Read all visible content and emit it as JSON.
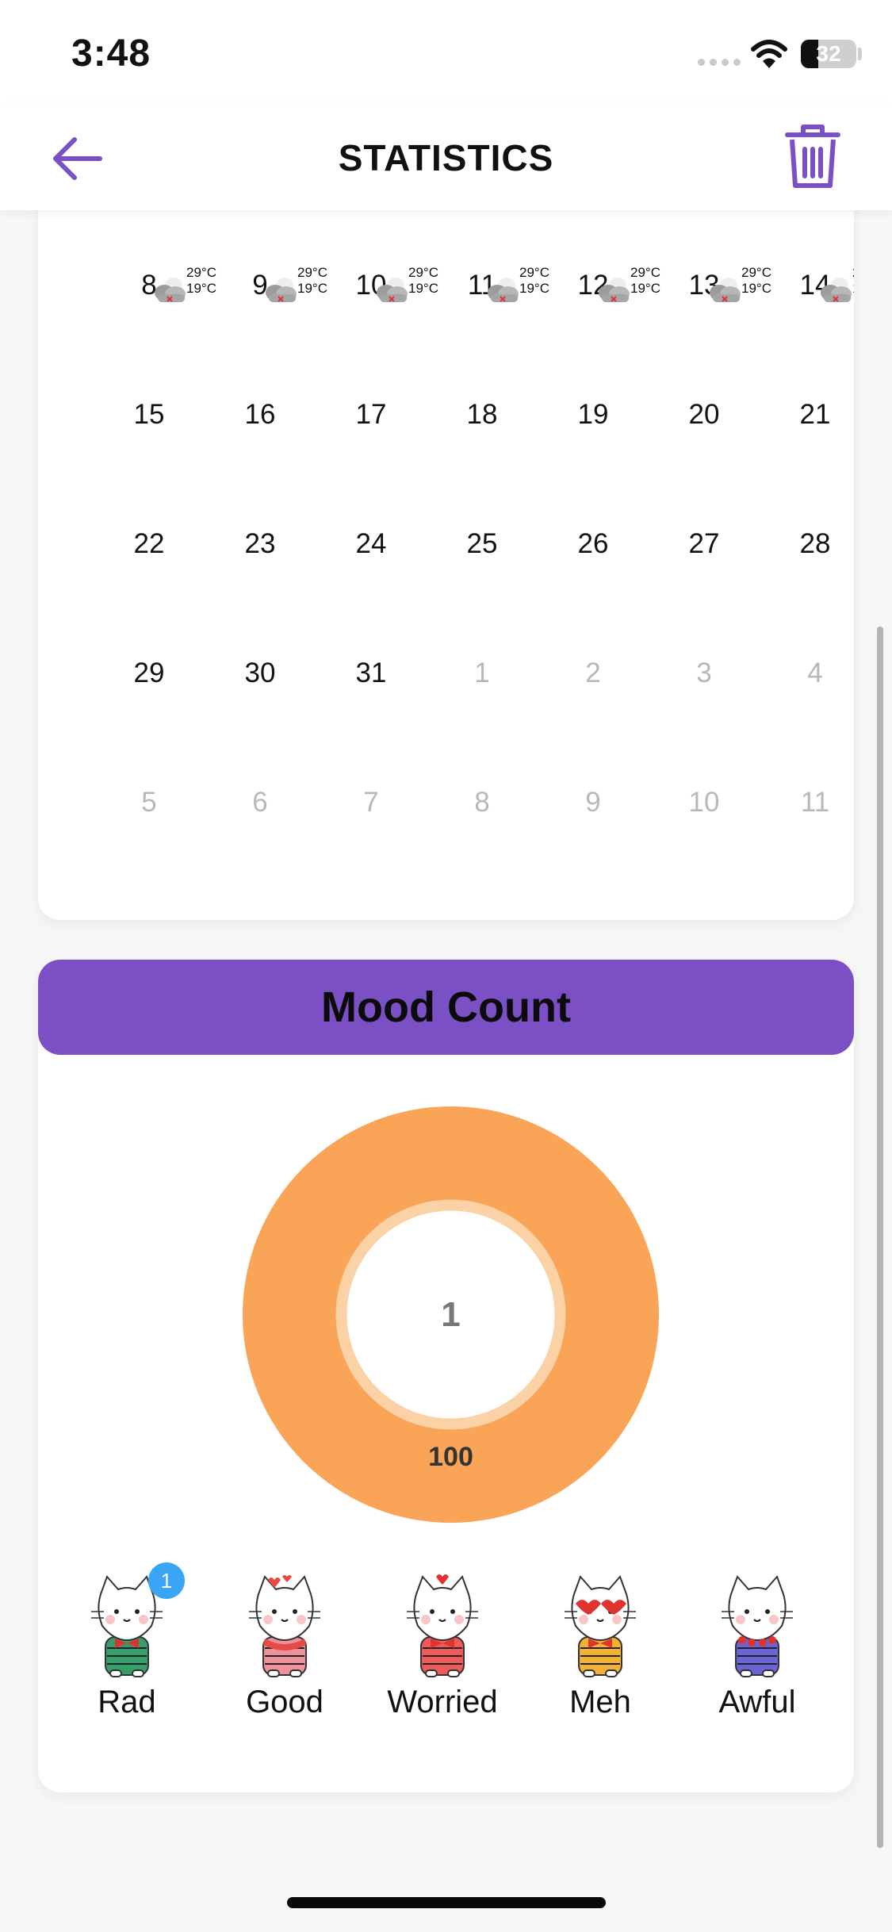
{
  "status_bar": {
    "time": "3:48",
    "battery_level": "32",
    "battery_fraction": 0.32
  },
  "header": {
    "title": "STATISTICS",
    "back_icon": "arrow-left-icon",
    "delete_icon": "trash-icon"
  },
  "calendar": {
    "weather": {
      "high": "29°C",
      "low": "19°C"
    },
    "rows": [
      [
        {
          "day": "8",
          "muted": false,
          "weather": true
        },
        {
          "day": "9",
          "muted": false,
          "weather": true
        },
        {
          "day": "10",
          "muted": false,
          "weather": true
        },
        {
          "day": "11",
          "muted": false,
          "weather": true
        },
        {
          "day": "12",
          "muted": false,
          "weather": true
        },
        {
          "day": "13",
          "muted": false,
          "weather": true
        },
        {
          "day": "14",
          "muted": false,
          "weather": true
        }
      ],
      [
        {
          "day": "15",
          "muted": false
        },
        {
          "day": "16",
          "muted": false
        },
        {
          "day": "17",
          "muted": false
        },
        {
          "day": "18",
          "muted": false
        },
        {
          "day": "19",
          "muted": false
        },
        {
          "day": "20",
          "muted": false
        },
        {
          "day": "21",
          "muted": false
        }
      ],
      [
        {
          "day": "22",
          "muted": false
        },
        {
          "day": "23",
          "muted": false
        },
        {
          "day": "24",
          "muted": false
        },
        {
          "day": "25",
          "muted": false
        },
        {
          "day": "26",
          "muted": false
        },
        {
          "day": "27",
          "muted": false
        },
        {
          "day": "28",
          "muted": false
        }
      ],
      [
        {
          "day": "29",
          "muted": false
        },
        {
          "day": "30",
          "muted": false
        },
        {
          "day": "31",
          "muted": false
        },
        {
          "day": "1",
          "muted": true
        },
        {
          "day": "2",
          "muted": true
        },
        {
          "day": "3",
          "muted": true
        },
        {
          "day": "4",
          "muted": true
        }
      ],
      [
        {
          "day": "5",
          "muted": true
        },
        {
          "day": "6",
          "muted": true
        },
        {
          "day": "7",
          "muted": true
        },
        {
          "day": "8",
          "muted": true
        },
        {
          "day": "9",
          "muted": true
        },
        {
          "day": "10",
          "muted": true
        },
        {
          "day": "11",
          "muted": true
        }
      ]
    ]
  },
  "mood_count": {
    "title": "Mood Count",
    "center_value": "1",
    "segment_label": "100",
    "moods": [
      {
        "label": "Rad",
        "count": "1",
        "shirt": "#37a06a",
        "accent": "#e0332f"
      },
      {
        "label": "Good",
        "count": null,
        "shirt": "#f0909a",
        "accent": "#e34b45"
      },
      {
        "label": "Worried",
        "count": null,
        "shirt": "#ef5a5a",
        "accent": "#e0332f"
      },
      {
        "label": "Meh",
        "count": null,
        "shirt": "#f2b233",
        "accent": "#e0332f"
      },
      {
        "label": "Awful",
        "count": null,
        "shirt": "#6a64d6",
        "accent": "#e0332f"
      }
    ]
  },
  "colors": {
    "accent_purple": "#7c50c5",
    "donut_orange": "#f9a457",
    "donut_inner_ring": "#fbd1a6",
    "badge_blue": "#3aa4f5"
  }
}
